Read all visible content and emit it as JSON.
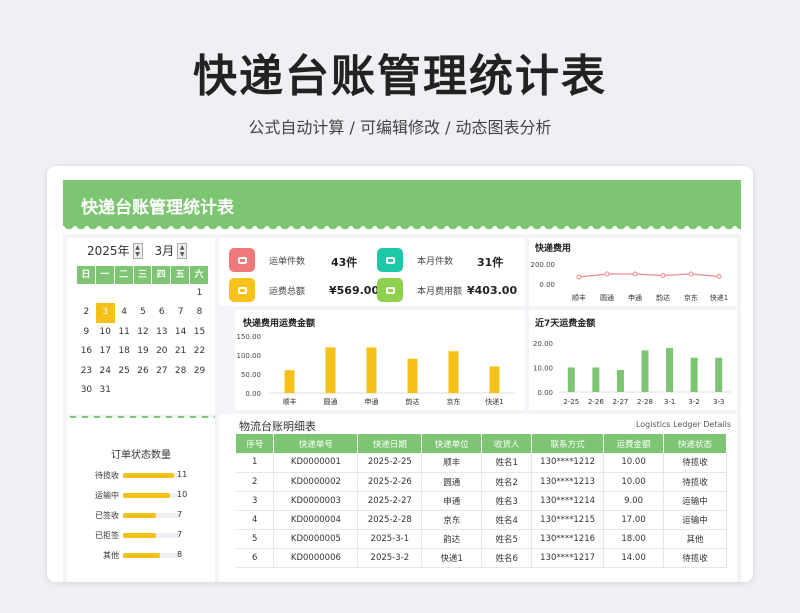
{
  "title": "快递台账管理统计表",
  "subtitle": "公式自动计算 /  可编辑修改  / 动态图表分析",
  "banner": "快递台账管理统计表",
  "calendar": {
    "year": "2025年",
    "month": "3月",
    "weekdays": [
      "日",
      "一",
      "二",
      "三",
      "四",
      "五",
      "六"
    ],
    "days": [
      "",
      "",
      "",
      "",
      "",
      "",
      "1",
      "2",
      "3",
      "4",
      "5",
      "6",
      "7",
      "8",
      "9",
      "10",
      "11",
      "12",
      "13",
      "14",
      "15",
      "16",
      "17",
      "18",
      "19",
      "20",
      "21",
      "22",
      "23",
      "24",
      "25",
      "26",
      "27",
      "28",
      "29",
      "30",
      "31"
    ],
    "today": "3"
  },
  "stats": {
    "waybill_label": "运单件数",
    "waybill_value": "43件",
    "month_label": "本月件数",
    "month_value": "31件",
    "total_fee_label": "运费总额",
    "total_fee_value": "¥569.00",
    "month_fee_label": "本月费用额",
    "month_fee_value": "¥403.00"
  },
  "colors": {
    "green": "#7dc573",
    "yellow": "#f5c018",
    "red_icon": "#f07a7a",
    "teal_icon": "#1dc8a8",
    "yellow_icon": "#f7c21c",
    "green_icon": "#8fd14f"
  },
  "status_title": "订单状态数量",
  "status_items": [
    {
      "label": "待揽收",
      "value": "11",
      "v": 11
    },
    {
      "label": "运输中",
      "value": "10",
      "v": 10
    },
    {
      "label": "已签收",
      "value": "7",
      "v": 7
    },
    {
      "label": "已拒签",
      "value": "7",
      "v": 7
    },
    {
      "label": "其他",
      "value": "8",
      "v": 8
    }
  ],
  "chart_data": [
    {
      "type": "line",
      "title": "快递费用",
      "categories": [
        "顺丰",
        "圆通",
        "申通",
        "韵达",
        "京东",
        "快递1"
      ],
      "values": [
        70,
        100,
        100,
        85,
        100,
        75
      ],
      "yticks": [
        "200.00",
        "0.00"
      ],
      "ylim": [
        0,
        200
      ]
    },
    {
      "type": "bar",
      "title": "快递费用运费金额",
      "categories": [
        "顺丰",
        "圆通",
        "申通",
        "韵达",
        "京东",
        "快递1"
      ],
      "values": [
        60,
        120,
        120,
        90,
        110,
        70
      ],
      "yticks": [
        "150.00",
        "100.00",
        "50.00",
        "0.00"
      ],
      "ylim": [
        0,
        150
      ]
    },
    {
      "type": "bar",
      "title": "近7天运费金额",
      "categories": [
        "2-25",
        "2-26",
        "2-27",
        "2-28",
        "3-1",
        "3-2",
        "3-3"
      ],
      "values": [
        10,
        10,
        9,
        17,
        18,
        14,
        14
      ],
      "yticks": [
        "20.00",
        "10.00",
        "0.00"
      ],
      "ylim": [
        0,
        20
      ]
    }
  ],
  "ledger": {
    "title": "物流台账明细表",
    "subtitle": "Logistics Ledger Details",
    "headers": [
      "序号",
      "快递单号",
      "快递日期",
      "快递单位",
      "收货人",
      "联系方式",
      "运费金额",
      "快递状态"
    ],
    "rows": [
      [
        "1",
        "KD0000001",
        "2025-2-25",
        "顺丰",
        "姓名1",
        "130****1212",
        "10.00",
        "待揽收"
      ],
      [
        "2",
        "KD0000002",
        "2025-2-26",
        "圆通",
        "姓名2",
        "130****1213",
        "10.00",
        "待揽收"
      ],
      [
        "3",
        "KD0000003",
        "2025-2-27",
        "申通",
        "姓名3",
        "130****1214",
        "9.00",
        "运输中"
      ],
      [
        "4",
        "KD0000004",
        "2025-2-28",
        "京东",
        "姓名4",
        "130****1215",
        "17.00",
        "运输中"
      ],
      [
        "5",
        "KD0000005",
        "2025-3-1",
        "韵达",
        "姓名5",
        "130****1216",
        "18.00",
        "其他"
      ],
      [
        "6",
        "KD0000006",
        "2025-3-2",
        "快递1",
        "姓名6",
        "130****1217",
        "14.00",
        "待揽收"
      ]
    ]
  }
}
